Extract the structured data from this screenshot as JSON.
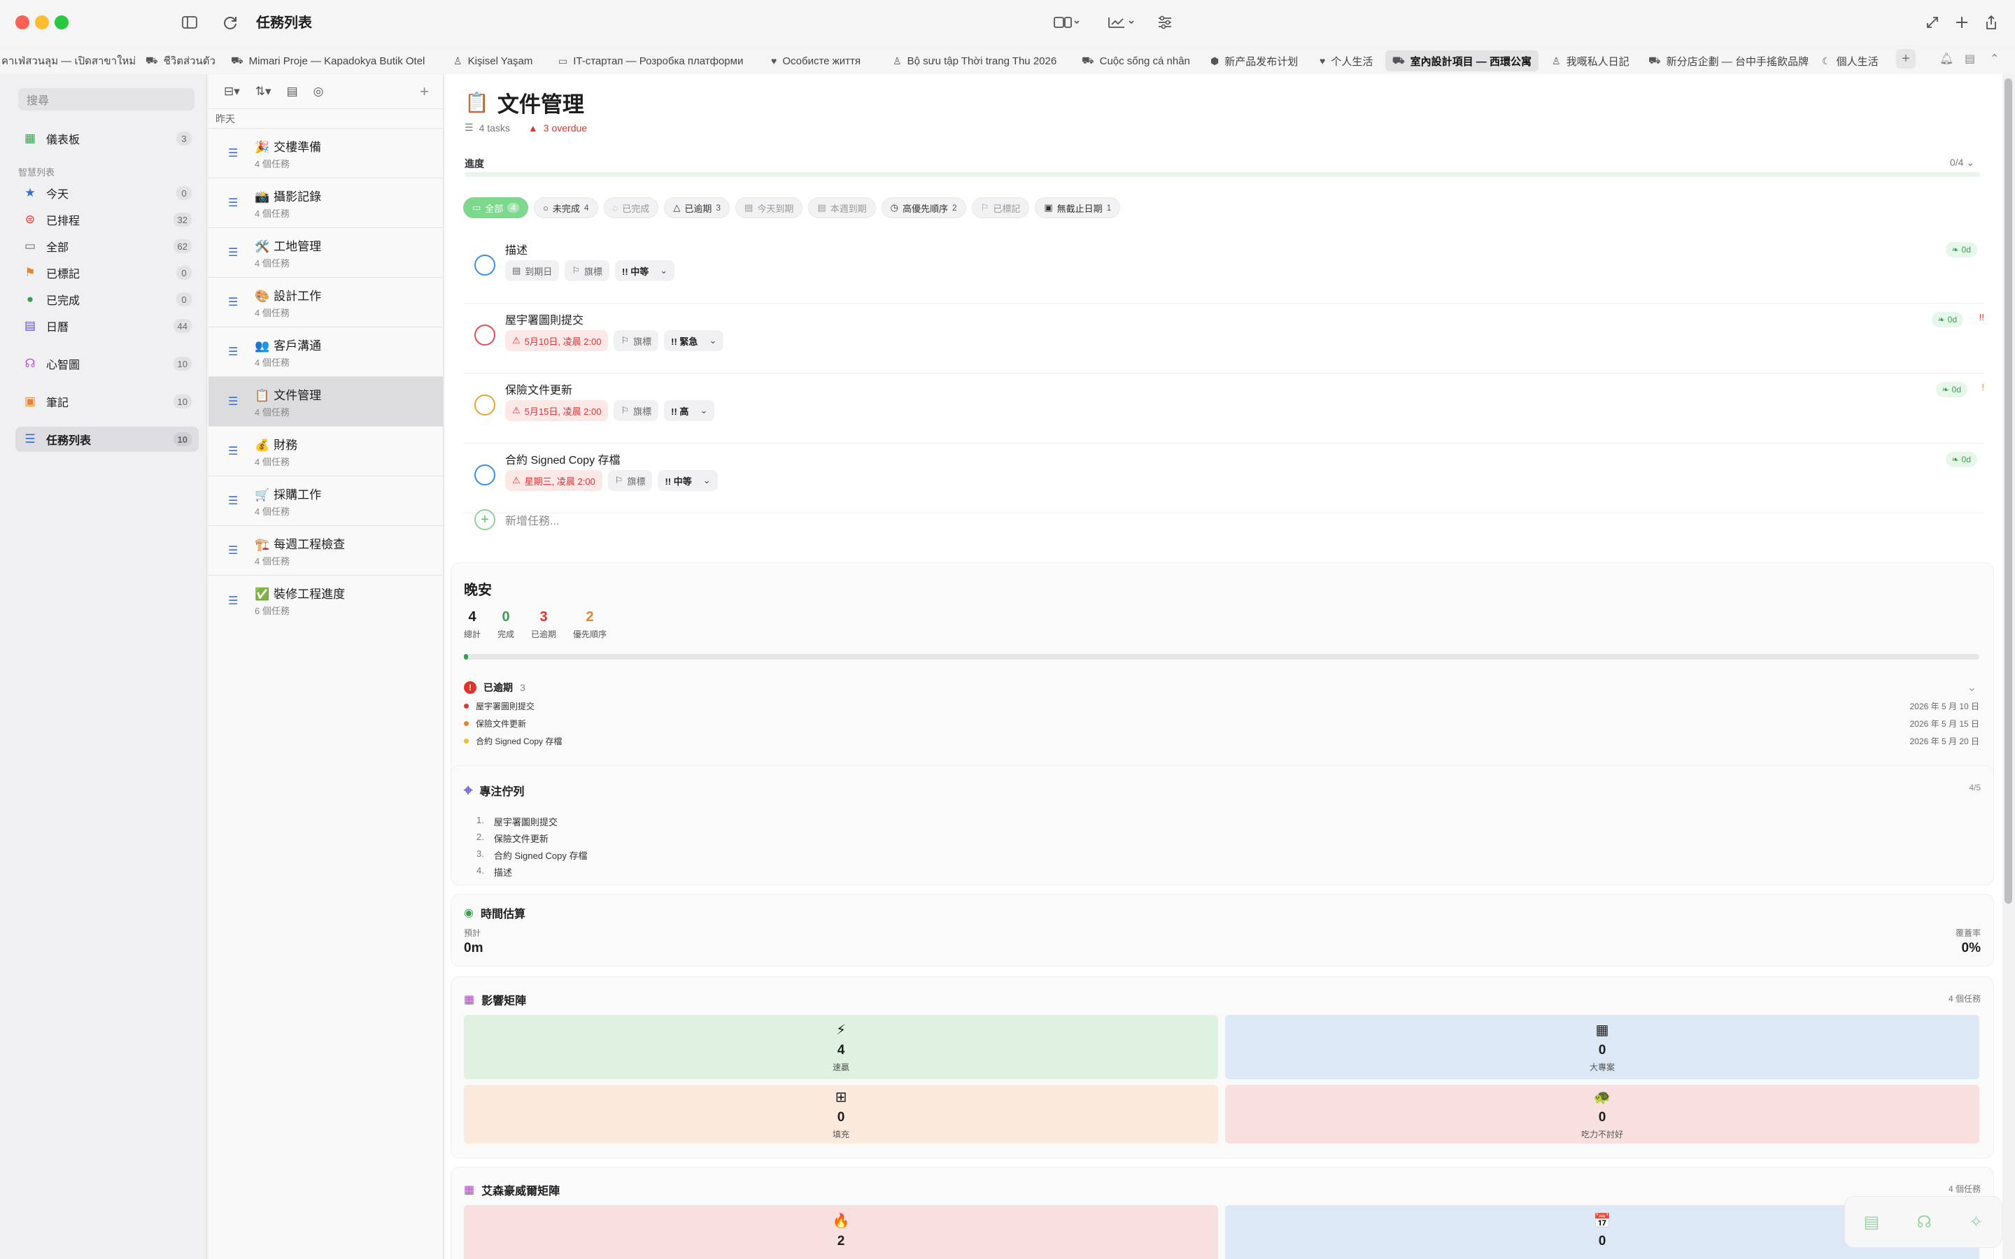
{
  "app": {
    "title": "任務列表"
  },
  "tabs": [
    {
      "label": "คาเฟ่สวนลุม — เปิดสาขาใหม่",
      "icon": "doc"
    },
    {
      "label": "ชีวิตส่วนตัว",
      "icon": "doc"
    },
    {
      "label": "Mimari Proje — Kapadokya Butik Otel",
      "icon": "car"
    },
    {
      "label": "Kişisel Yaşam",
      "icon": "person"
    },
    {
      "label": "IT-стартап — Розробка платформи",
      "icon": "laptop"
    },
    {
      "label": "Особисте життя",
      "icon": "heart"
    },
    {
      "label": "Bộ sưu tập Thời trang Thu 2026",
      "icon": "person"
    },
    {
      "label": "Cuộc sống cá nhân",
      "icon": "doc"
    },
    {
      "label": "新产品发布计划",
      "icon": "box"
    },
    {
      "label": "个人生活",
      "icon": "heart"
    },
    {
      "label": "室內設計項目 — 西環公寓",
      "icon": "car",
      "active": true
    },
    {
      "label": "我嘅私人日記",
      "icon": "person"
    },
    {
      "label": "新分店企劃 — 台中手搖飲品牌",
      "icon": "car"
    },
    {
      "label": "個人生活",
      "icon": "moon"
    }
  ],
  "sidebar": {
    "search_placeholder": "搜尋",
    "section_label": "智慧列表",
    "items": [
      {
        "label": "儀表板",
        "count": "3",
        "icon": "dashboard",
        "color": "#3aa04f"
      },
      {
        "label": "今天",
        "count": "0",
        "icon": "star",
        "color": "#2b6fd6"
      },
      {
        "label": "已排程",
        "count": "32",
        "icon": "calendar-badge",
        "color": "#e0342b"
      },
      {
        "label": "全部",
        "count": "62",
        "icon": "tray",
        "color": "#666666"
      },
      {
        "label": "已標記",
        "count": "0",
        "icon": "flag",
        "color": "#e8822c"
      },
      {
        "label": "已完成",
        "count": "0",
        "icon": "check",
        "color": "#3aa04f"
      },
      {
        "label": "日曆",
        "count": "44",
        "icon": "calendar",
        "color": "#5a4fcf"
      },
      {
        "label": "心智圖",
        "count": "10",
        "icon": "brain",
        "color": "#c04fcf"
      },
      {
        "label": "筆記",
        "count": "10",
        "icon": "notes",
        "color": "#e8822c"
      },
      {
        "label": "任務列表",
        "count": "10",
        "icon": "list",
        "color": "#2b6fd6",
        "active": true
      }
    ]
  },
  "list": {
    "group": "昨天",
    "items": [
      {
        "emoji": "🎉",
        "name": "交樓準備",
        "sub": "4 個任務"
      },
      {
        "emoji": "📸",
        "name": "攝影記錄",
        "sub": "4 個任務"
      },
      {
        "emoji": "🛠️",
        "name": "工地管理",
        "sub": "4 個任務"
      },
      {
        "emoji": "🎨",
        "name": "設計工作",
        "sub": "4 個任務"
      },
      {
        "emoji": "👥",
        "name": "客戶溝通",
        "sub": "4 個任務"
      },
      {
        "emoji": "📋",
        "name": "文件管理",
        "sub": "4 個任務",
        "active": true
      },
      {
        "emoji": "💰",
        "name": "財務",
        "sub": "4 個任務"
      },
      {
        "emoji": "🛒",
        "name": "採購工作",
        "sub": "4 個任務"
      },
      {
        "emoji": "🏗️",
        "name": "每週工程檢查",
        "sub": "4 個任務"
      },
      {
        "emoji": "✅",
        "name": "裝修工程進度",
        "sub": "6 個任務"
      }
    ]
  },
  "main": {
    "title": "文件管理",
    "title_emoji": "📋",
    "tasks_count": "4 tasks",
    "overdue_label": "3 overdue",
    "progress_label": "進度",
    "progress_value": "0/4",
    "progress_fraction": 0,
    "filters": [
      {
        "label": "全部",
        "count": "4",
        "on": true
      },
      {
        "label": "未完成",
        "count": "4"
      },
      {
        "label": "已完成",
        "count": "",
        "dim": true
      },
      {
        "label": "已逾期",
        "count": "3"
      },
      {
        "label": "今天到期",
        "count": "",
        "dim": true
      },
      {
        "label": "本週到期",
        "count": "",
        "dim": true
      },
      {
        "label": "高優先順序",
        "count": "2"
      },
      {
        "label": "已標記",
        "count": "",
        "dim": true
      },
      {
        "label": "無截止日期",
        "count": "1"
      }
    ],
    "tasks": [
      {
        "name": "描述",
        "date": "到期日",
        "date_red": false,
        "flag": "旗標",
        "priority": "!! 中等",
        "age": "0d",
        "mark": "",
        "circle": "#3b8ee0"
      },
      {
        "name": "屋宇署圖則提交",
        "date": "5月10日, 凌晨 2:00",
        "date_red": true,
        "flag": "旗標",
        "priority": "!! 緊急",
        "age": "0d",
        "mark": "!!",
        "circle": "#e05050"
      },
      {
        "name": "保險文件更新",
        "date": "5月15日, 凌晨 2:00",
        "date_red": true,
        "flag": "旗標",
        "priority": "!! 高",
        "age": "0d",
        "mark": "!",
        "circle": "#e8a23c"
      },
      {
        "name": "合約 Signed Copy 存檔",
        "date": "星期三, 凌晨 2:00",
        "date_red": true,
        "flag": "旗標",
        "priority": "!! 中等",
        "age": "0d",
        "mark": "",
        "circle": "#3b8ee0"
      }
    ],
    "add_task": "新增任務..."
  },
  "summary": {
    "title": "晚安",
    "stats": [
      {
        "value": "4",
        "label": "總計",
        "tone": "plain"
      },
      {
        "value": "0",
        "label": "完成",
        "tone": "green"
      },
      {
        "value": "3",
        "label": "已逾期",
        "tone": "red"
      },
      {
        "value": "2",
        "label": "優先順序",
        "tone": "orange"
      }
    ],
    "completion_fraction": 0.003,
    "overdue_title": "已逾期",
    "overdue_count": "3",
    "overdue_items": [
      {
        "name": "屋宇署圖則提交",
        "date": "2026 年 5 月 10 日",
        "color": "#e0342b"
      },
      {
        "name": "保險文件更新",
        "date": "2026 年 5 月 15 日",
        "color": "#e8822c"
      },
      {
        "name": "合約 Signed Copy 存檔",
        "date": "2026 年 5 月 20 日",
        "color": "#e8c22c"
      }
    ]
  },
  "focus": {
    "title": "專注佇列",
    "count": "4/5",
    "items": [
      "屋宇署圖則提交",
      "保險文件更新",
      "合約 Signed Copy 存檔",
      "描述"
    ]
  },
  "time": {
    "title": "時間估算",
    "est_label": "預計",
    "est_value": "0m",
    "cover_label": "覆蓋率",
    "cover_value": "0%"
  },
  "impact": {
    "title": "影響矩陣",
    "count": "4 個任務",
    "cells": [
      {
        "value": "4",
        "label": "速贏",
        "icon": "⚡",
        "color": "#dff2e2"
      },
      {
        "value": "0",
        "label": "大專案",
        "icon": "▦",
        "color": "#dce8f6"
      },
      {
        "value": "0",
        "label": "填充",
        "icon": "⊞",
        "color": "#fbe9dc"
      },
      {
        "value": "0",
        "label": "吃力不討好",
        "icon": "🐢",
        "color": "#f9e0e0"
      }
    ]
  },
  "eisenhower": {
    "title": "艾森豪威爾矩陣",
    "count": "4 個任務",
    "cells": [
      {
        "value": "2",
        "icon": "🔥",
        "color": "#f9e0e0"
      },
      {
        "value": "0",
        "icon": "📅",
        "color": "#dce8f6"
      }
    ]
  }
}
